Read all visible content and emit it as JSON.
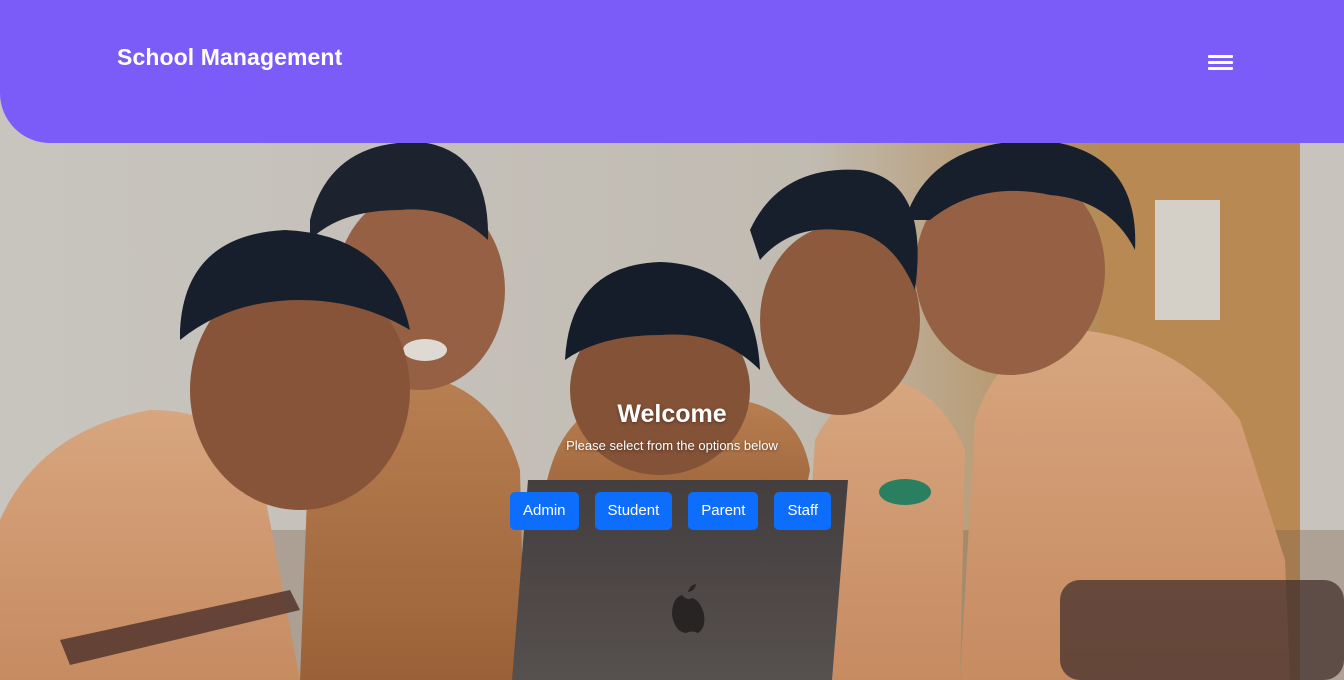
{
  "header": {
    "brand": "School Management",
    "menu_icon": "hamburger-menu-icon"
  },
  "welcome": {
    "title": "Welcome",
    "subtitle": "Please select from the options below"
  },
  "options": [
    {
      "label": "Admin"
    },
    {
      "label": "Student"
    },
    {
      "label": "Parent"
    },
    {
      "label": "Staff"
    }
  ],
  "colors": {
    "header_bg": "#7b5cf9",
    "button_bg": "#0d6efd",
    "text_light": "#ffffff"
  }
}
